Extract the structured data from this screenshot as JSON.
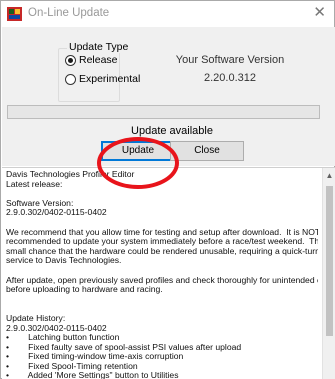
{
  "window": {
    "title": "On-Line Update",
    "close_glyph": "✕",
    "icon": "app-logo-icon"
  },
  "update_type": {
    "legend": "Update Type",
    "options": [
      {
        "label": "Release",
        "checked": true
      },
      {
        "label": "Experimental",
        "checked": false
      }
    ]
  },
  "version": {
    "label": "Your Software Version",
    "value": "2.20.0.312"
  },
  "progress": {
    "percent": 0
  },
  "status_text": "Update available",
  "buttons": {
    "update": "Update",
    "close": "Close"
  },
  "notes": {
    "lines": [
      "Davis Technologies Profiler Editor",
      "Latest release:",
      "",
      "Software Version:",
      "2.9.0.302/0402-0115-0402",
      "",
      "We recommend that you allow time for testing and setup after download.  It is NOT",
      "recommended to update your system immediately before a race/test weekend.  There is a",
      "small chance that the hardware could be rendered unusable, requiring a quick-turnaround",
      "service to Davis Technologies.",
      "",
      "After update, open previously saved profiles and check thoroughly for unintended changes",
      "before uploading to hardware and racing.",
      "",
      "",
      "Update History:",
      "2.9.0.302/0402-0115-0402",
      "•\t\tLatching button function",
      "•\t\tFixed faulty save of spool-assist PSI values after upload",
      "•\t\tFixed timing-window time-axis corruption",
      "•\t\tFixed Spool-Timing retention",
      "•\t\tAdded 'More Settings\" button to Utilities"
    ]
  },
  "colors": {
    "highlight": "#e8141b",
    "focus": "#0078d7",
    "panel": "#f0f0f0"
  }
}
